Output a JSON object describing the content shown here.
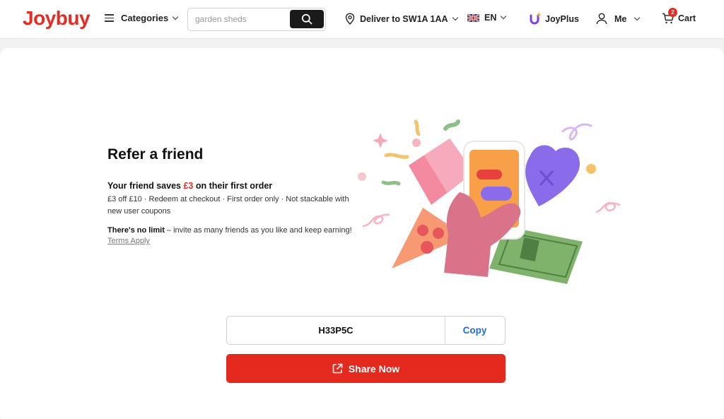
{
  "header": {
    "logo": "Joybuy",
    "categories_label": "Categories",
    "search": {
      "placeholder": "garden sheds",
      "value": ""
    },
    "deliver_label": "Deliver to SW1A 1AA",
    "language": "EN",
    "joyplus_label": "JoyPlus",
    "me_label": "Me",
    "cart_label": "Cart",
    "cart_count": "2"
  },
  "referral": {
    "title": "Refer a friend",
    "save_prefix": "Your friend saves ",
    "save_amount": "£3",
    "save_suffix": " on their first order",
    "details": "£3 off £10 · Redeem at checkout · First order only · Not stackable with new user coupons",
    "no_limit_bold": "There's no limit",
    "no_limit_rest": " – invite as many friends as you like and keep earning!",
    "terms_label": "Terms Apply",
    "code": "H33P5C",
    "copy_label": "Copy",
    "share_label": "Share Now"
  },
  "colors": {
    "brand": "#e52c22",
    "link": "#1f6de0"
  },
  "icons": [
    "menu-icon",
    "search-icon",
    "location-pin-icon",
    "uk-flag-icon",
    "joyplus-icon",
    "user-icon",
    "cart-icon",
    "share-icon"
  ]
}
